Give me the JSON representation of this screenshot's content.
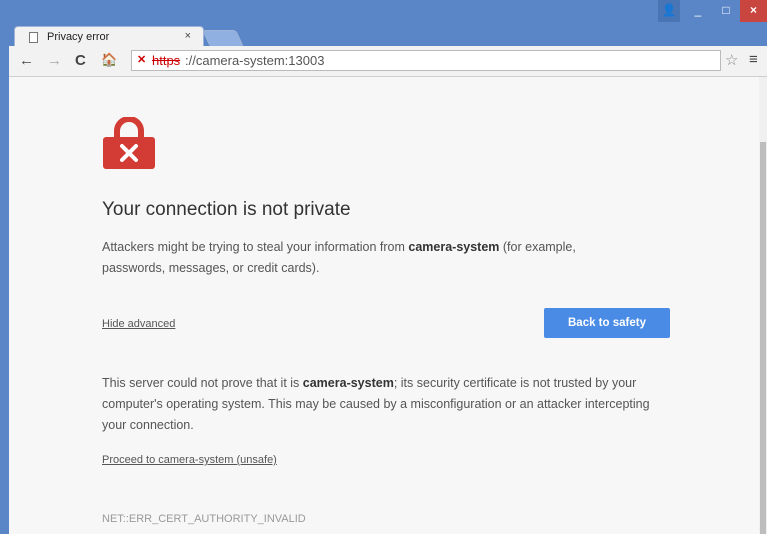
{
  "tab": {
    "title": "Privacy error",
    "close": "×"
  },
  "window": {
    "user": "👤",
    "min": "_",
    "max": "□",
    "close": "×"
  },
  "toolbar": {
    "back": "←",
    "forward": "→",
    "reload": "C",
    "home": "🏠"
  },
  "address": {
    "scheme": "https",
    "rest": "://camera-system:13003"
  },
  "page": {
    "title": "Your connection is not private",
    "p1_a": "Attackers might be trying to steal your information from ",
    "p1_host": "camera-system",
    "p1_b": " (for example, passwords, messages, or credit cards).",
    "hide_advanced": "Hide advanced",
    "back_button": "Back to safety",
    "p2_a": "This server could not prove that it is ",
    "p2_host": "camera-system",
    "p2_b": "; its security certificate is not trusted by your computer's operating system. This may be caused by a misconfiguration or an attacker intercepting your connection.",
    "proceed_link": "Proceed to camera-system (unsafe)",
    "error_code": "NET::ERR_CERT_AUTHORITY_INVALID"
  },
  "colors": {
    "accent": "#4a8be5",
    "lock": "#d33b35",
    "frame": "#5a86c8"
  }
}
